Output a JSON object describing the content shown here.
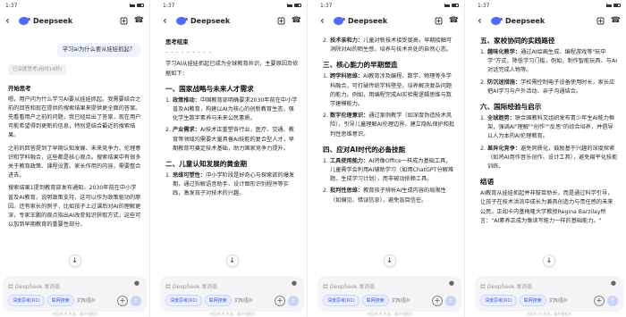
{
  "status": {
    "time": "1:37"
  },
  "app": {
    "name": "Deepseek"
  },
  "composer": {
    "placeholder": "给 DeepSeek 发消息",
    "deep_think": "深度思考(R1)",
    "web_search": "联网搜索",
    "doc_note": "文档/图片",
    "footer": "内容由 AI 生成，请仔细甄别"
  },
  "panel1": {
    "user_message": "学习ai为什么要从娃娃抓起？",
    "thinking": "已深度思考(用时14秒)",
    "heading": "开始思考",
    "paragraphs": [
      "嗯，用户问为什么学习AI要从娃娃抓起。我需要结合之前的回答和现在提供的搜索结果来提供更全面的答案。先看看用户之前的问题，我已经给出了答案，现在用户可能希望得到更新的信息，特别是结合最近的搜索结果。",
      "之前的回答提到了早期认知发展、未来竞争力、伦理意识和学科融合，这些都是核心观点。搜索结果中有很多关于教育政策、课程设置、家长作用的内容，需要整合进去。",
      "搜索结果1提到教育部发布通知，2030年前在中小学普及AI教育，说明政策支持，这可以作为政策驱动的原因。还有家长的例子，比如孩子上过课后对AI的理解更深，专家王鹏的观点指出AI改变知识获取方式，这些可以加到早期教育的重要性部分。"
    ]
  },
  "panel2": {
    "heading": "思考结束",
    "divider": "- - - - - - - - -",
    "intro": "学习AI从娃娃抓起已成为全球教育共识，主要原因及依据如下：",
    "section1_title": "一、国家战略与未来人才需求",
    "section1_items": [
      {
        "num": "1.",
        "title": "政策推动：",
        "text": "中国教育部明确要求2030年前在中小学普及AI教育，构建以AI为核心的创新教育生态，强化学生数字素养与未来公民素质。"
      },
      {
        "num": "2.",
        "title": "产业需求：",
        "text": "AI技术正重塑各行业，医疗、交通、教育等领域均需要大量具备AI技能的复合型人才，早期教育可奠定技术基础，助力国家竞争力提升。"
      }
    ],
    "section2_title": "二、儿童认知发展的黄金期",
    "section2_items": [
      {
        "num": "1.",
        "title": "思维可塑性：",
        "text": "中小学阶段是好奇心与探索欲的爆发期，通过拆解语音助手、设计图形识别程序等实践，激发孩子对技术的兴趣。"
      }
    ]
  },
  "panel3": {
    "items_top": [
      {
        "num": "2.",
        "title": "技术亲和力：",
        "text": "儿童对新技术接受度高，早期接触可消除对AI的陌生感，培养与技术共处的自然心态。"
      }
    ],
    "section3_title": "三、核心能力的早期塑造",
    "section3_items": [
      {
        "num": "1.",
        "title": "跨学科思维：",
        "text": "AI教育涉及编程、数学、物理等多学科融合，可打破传统学科壁垒，培养解决复杂问题的能力。例如，用编程完成AI实验需逻辑思维与数学建模能力。"
      },
      {
        "num": "2.",
        "title": "数字伦理意识：",
        "text": "通过案例教学（如深度伪造技术风险），引导儿童理解AI伦理边界，建立隐私保护和批判性思维意识。"
      }
    ],
    "section4_title": "四、应对AI时代的必备技能",
    "section4_items": [
      {
        "num": "1.",
        "title": "工具使用能力：",
        "text": "AI将像Office一样成为基础工具，儿童需学会利用AI辅助学习（如用ChatGPT分解难题、生成学习计划），而非被动依赖工具。"
      },
      {
        "num": "2.",
        "title": "批判性思维：",
        "text": "教育孩子辨析AI生成内容的局限性（如偏见、错误信息），避免盲目信任。"
      }
    ]
  },
  "panel4": {
    "section5_title": "五、家校协同的实践路径",
    "section5_items": [
      {
        "num": "1.",
        "title": "趣味化教学：",
        "text": "通过AI绘画生成、编程游戏等\"玩中学\"方式，降低学习门槛，例如，制作智能玩具、与AI对话完成人物等。"
      },
      {
        "num": "2.",
        "title": "防沉迷措施：",
        "text": "学校需控制电子设备使用时长，家长应把AI学习与户外活动、亲子沟通结合。"
      }
    ],
    "section6_title": "六、国际经验与启示",
    "section6_items": [
      {
        "num": "1.",
        "title": "全球趋势：",
        "text": "联合国教科文组织发布青少年生AI能力框架，强调AI\"理解\"\"创作\"\"反思\"的综合培养，并倡导以人为本的AI伦理教育。"
      },
      {
        "num": "2.",
        "title": "差异化竞争：",
        "text": "避免同质化，鼓励基于兴趣的深度探索（如将AI用作音乐创作、设计工具），避免扁平化技能训练。"
      }
    ],
    "conclusion_title": "结语",
    "conclusion_text": "AI教育从娃娃抓起并非拔苗助长，而是通过科学引导，让孩子在技术洪流中成长为兼具创造力与责任感的未来公民。正如卡内基梅隆大学教授Regina Barzilay所言：\"AI素养正成为像读写能力一样的基础能力。\""
  }
}
